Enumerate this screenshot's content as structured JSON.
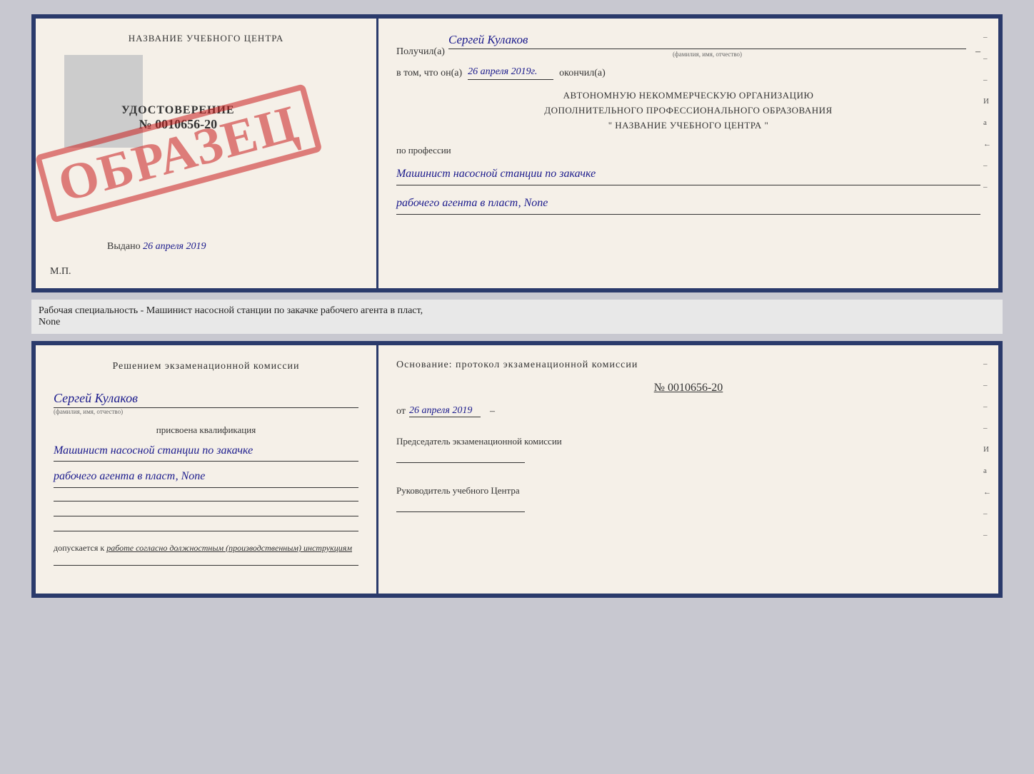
{
  "top_document": {
    "left": {
      "school_name": "НАЗВАНИЕ УЧЕБНОГО ЦЕНТРА",
      "udostoverenie_title": "УДОСТОВЕРЕНИЕ",
      "udostoverenie_num": "№ 0010656-20",
      "vydano_label": "Выдано",
      "vydano_date": "26 апреля 2019",
      "mp_label": "М.П."
    },
    "stamp": "ОБРАЗЕЦ",
    "right": {
      "recipient_label": "Получил(а)",
      "recipient_name": "Сергей Кулаков",
      "recipient_subtitle": "(фамилия, имя, отчество)",
      "dash": "–",
      "date_prefix": "в том, что он(а)",
      "date_value": "26 апреля 2019г.",
      "okончил_label": "окончил(а)",
      "org_line1": "АВТОНОМНУЮ НЕКОММЕРЧЕСКУЮ ОРГАНИЗАЦИЮ",
      "org_line2": "ДОПОЛНИТЕЛЬНОГО ПРОФЕССИОНАЛЬНОГО ОБРАЗОВАНИЯ",
      "org_line3": "\" НАЗВАНИЕ УЧЕБНОГО ЦЕНТРА \"",
      "profession_label": "по профессии",
      "profession_line1": "Машинист насосной станции по закачке",
      "profession_line2": "рабочего агента в пласт, None",
      "side_marks": [
        "–",
        "–",
        "–",
        "И",
        "а",
        "←",
        "–",
        "–",
        "–",
        "–"
      ]
    }
  },
  "middle": {
    "text_line1": "Рабочая специальность - Машинист насосной станции по закачке рабочего агента в пласт,",
    "text_line2": "None"
  },
  "bottom_document": {
    "left": {
      "commission_title": "Решением экзаменационной комиссии",
      "person_name": "Сергей Кулаков",
      "person_subtitle": "(фамилия, имя, отчество)",
      "qualification_label": "присвоена квалификация",
      "qualification_line1": "Машинист насосной станции по закачке",
      "qualification_line2": "рабочего агента в пласт, None",
      "допускается_prefix": "допускается к",
      "допускается_value": "работе согласно должностным (производственным) инструкциям"
    },
    "right": {
      "osnov_title": "Основание: протокол экзаменационной комиссии",
      "protocol_num": "№ 0010656-20",
      "date_prefix": "от",
      "date_value": "26 апреля 2019",
      "chairman_title": "Председатель экзаменационной комиссии",
      "head_title": "Руководитель учебного Центра",
      "side_marks": [
        "–",
        "–",
        "–",
        "–",
        "–",
        "И",
        "а",
        "←",
        "–",
        "–",
        "–",
        "–",
        "–"
      ]
    }
  }
}
